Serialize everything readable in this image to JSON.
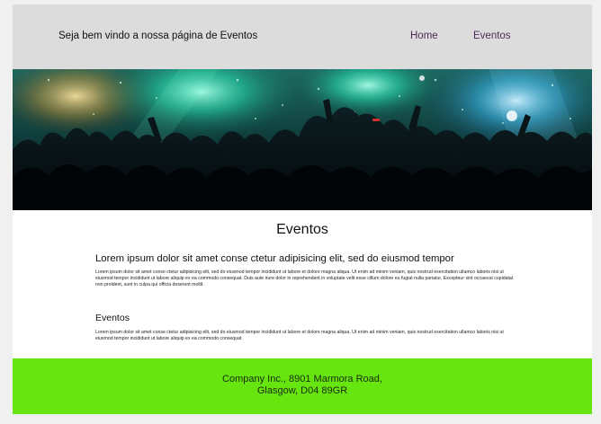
{
  "header": {
    "title": "Seja bem vindo a nossa página de Eventos",
    "nav": [
      "Home",
      "Eventos"
    ]
  },
  "hero": {
    "image": "concert-crowd-photo"
  },
  "main": {
    "title": "Eventos",
    "section1": {
      "heading": "Lorem ipsum dolor sit amet conse ctetur adipisicing elit, sed do eiusmod tempor",
      "paragraph": "Lorem ipsum dolor sit amet conse ctetur adipisicing elit, sed do eiusmod tempor incididunt ut labore et dolore magna aliqua. Ut enim ad minim veniam, quis nostrud exercitation ullamco laboris nisi ut eiusmod tempor incididunt ut labore  aliquip ex ea commodo consequat. Duis aute irure dolor in reprehenderit in voluptate velit esse cillum dolore eu fugiat nulla pariatur. Excepteur sint occaecat cupidatat non proident, sunt in culpa qui officia deserunt mollit."
    },
    "section2": {
      "heading": "Eventos",
      "paragraph": "Lorem ipsum dolor sit amet conse ctetur adipisicing elit, sed do eiusmod tempor incididunt ut labore et dolore magna aliqua. Ut enim ad minim veniam, quis nostrud exercitation ullamco laboris nisi ut eiusmod tempor incididunt ut labore  aliquip ex ea commodo consequat."
    }
  },
  "footer": {
    "line1": "Company Inc., 8901 Marmora Road,",
    "line2": "Glasgow, D04 89GR"
  },
  "colors": {
    "header_bg": "#dcdcdc",
    "nav_link": "#4b2b57",
    "footer_bg": "#66e60e"
  }
}
